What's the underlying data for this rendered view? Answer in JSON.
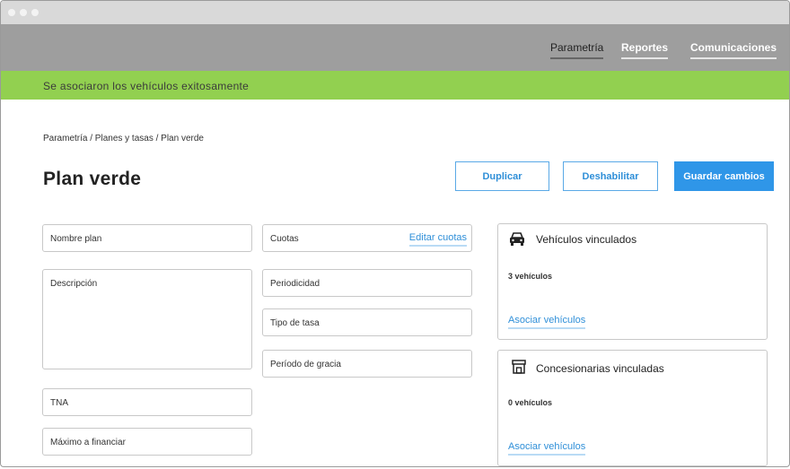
{
  "nav": {
    "items": [
      {
        "label": "Parametría",
        "active": true
      },
      {
        "label": "Reportes",
        "active": false
      },
      {
        "label": "Comunicaciones",
        "active": false
      }
    ]
  },
  "banner": {
    "message": "Se asociaron los vehículos exitosamente",
    "color": "#92d050"
  },
  "breadcrumb": "Parametría / Planes y tasas / Plan verde",
  "page_title": "Plan verde",
  "actions": {
    "duplicate": "Duplicar",
    "disable": "Deshabilitar",
    "save": "Guardar cambios"
  },
  "form": {
    "nombre_plan": "Nombre plan",
    "descripcion": "Descripción",
    "tna": "TNA",
    "maximo_financiar": "Máximo a financiar",
    "cuotas": "Cuotas",
    "editar_cuotas": "Editar cuotas",
    "periodicidad": "Periodicidad",
    "tipo_tasa": "Tipo de tasa",
    "periodo_gracia": "Período de gracia"
  },
  "cards": {
    "vehiculos": {
      "icon": "car-icon",
      "title": "Vehículos vinculados",
      "count": "3 vehículos",
      "link": "Asociar vehículos"
    },
    "concesionarias": {
      "icon": "store-icon",
      "title": "Concesionarias vinculadas",
      "count": "0 vehículos",
      "link": "Asociar vehículos"
    }
  },
  "colors": {
    "accent": "#2f96e8",
    "nav_bg": "#9e9e9e",
    "success": "#92d050"
  }
}
